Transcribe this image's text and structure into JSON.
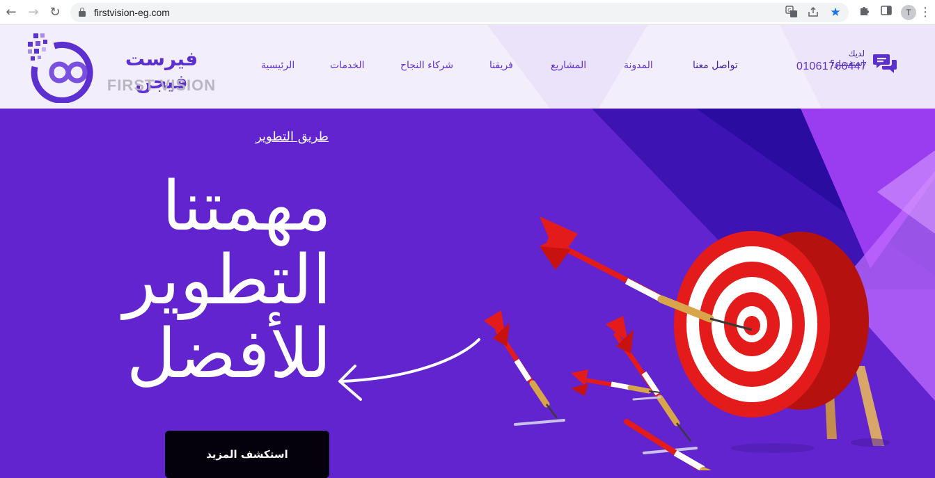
{
  "browser": {
    "url": "firstvision-eg.com",
    "profile_initial": "T",
    "icons": [
      "back-icon",
      "forward-icon",
      "reload-icon",
      "lock-icon",
      "translate-icon",
      "share-icon",
      "star-icon",
      "extensions-icon",
      "sidepanel-icon",
      "menu-icon"
    ]
  },
  "header": {
    "logo": {
      "arabic": "فيرست فيجن",
      "english": "FIRST VISION"
    },
    "nav": {
      "home": "الرئيسية",
      "services": "الخدمات",
      "partners": "شركاء النجاح",
      "team": "فريقنا",
      "projects": "المشاريع",
      "blog": "المدونة",
      "contact": "تواصل معنا"
    },
    "contact": {
      "question": "لديك إستفسار؟",
      "phone": "01061766447",
      "icon": "chat-icon"
    }
  },
  "hero": {
    "subtitle": "طريق التطوير",
    "title_lines": [
      "مهمتنا",
      "التطوير",
      "للأفضل"
    ],
    "cta": "استكشف المزيد"
  },
  "colors": {
    "brand_purple": "#5c2fd1",
    "hero_bg": "#6124cf",
    "header_bg": "#f3eefb",
    "cta_bg": "#04000c",
    "target_red": "#e31b1b"
  }
}
